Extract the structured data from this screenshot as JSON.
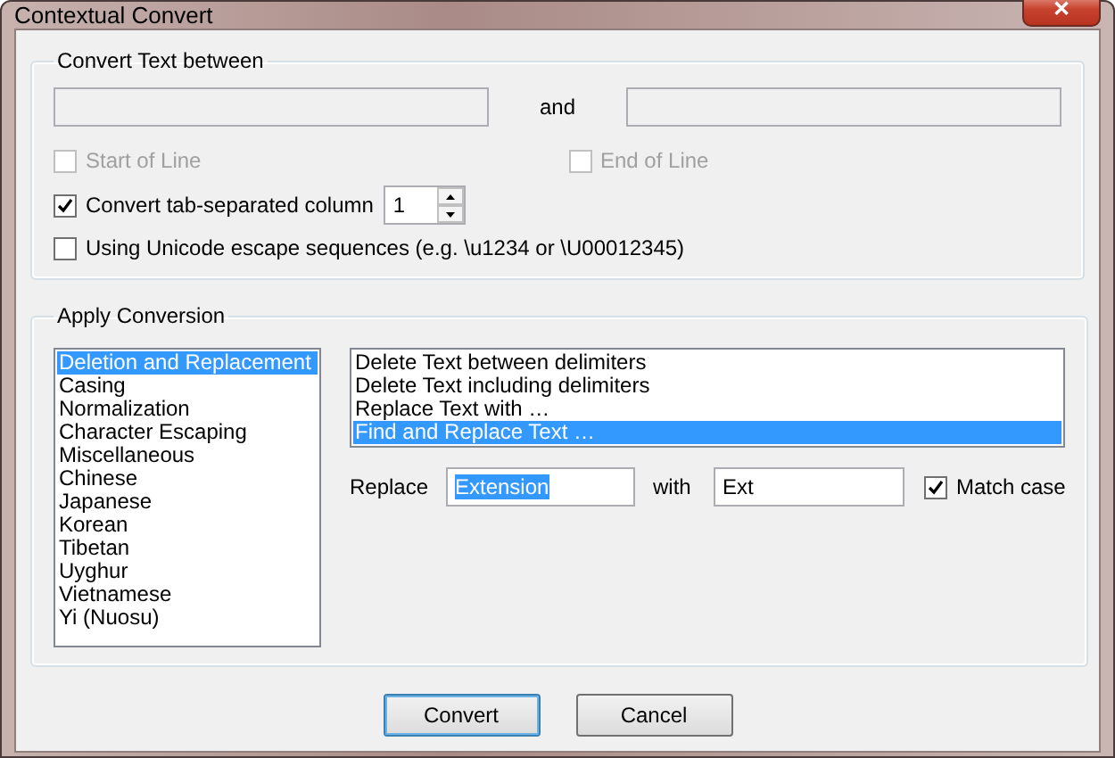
{
  "window": {
    "title": "Contextual Convert",
    "close": "✕"
  },
  "convert_between": {
    "title": "Convert Text between",
    "and_label": "and",
    "start_of_line": {
      "label": "Start of Line",
      "checked": false,
      "disabled": true
    },
    "end_of_line": {
      "label": "End of Line",
      "checked": false,
      "disabled": true
    },
    "tab_column": {
      "label": "Convert tab-separated column",
      "checked": true,
      "disabled": false,
      "value": "1"
    },
    "unicode_escape": {
      "label": "Using Unicode escape sequences (e.g.  \\u1234 or  \\U00012345)",
      "checked": false,
      "disabled": false
    }
  },
  "apply_conversion": {
    "title": "Apply Conversion",
    "categories": [
      {
        "label": "Deletion and Replacement",
        "selected": true
      },
      {
        "label": "Casing",
        "selected": false
      },
      {
        "label": "Normalization",
        "selected": false
      },
      {
        "label": "Character Escaping",
        "selected": false
      },
      {
        "label": "Miscellaneous",
        "selected": false
      },
      {
        "label": "Chinese",
        "selected": false
      },
      {
        "label": "Japanese",
        "selected": false
      },
      {
        "label": "Korean",
        "selected": false
      },
      {
        "label": "Tibetan",
        "selected": false
      },
      {
        "label": "Uyghur",
        "selected": false
      },
      {
        "label": "Vietnamese",
        "selected": false
      },
      {
        "label": "Yi (Nuosu)",
        "selected": false
      }
    ],
    "operations": [
      {
        "label": "Delete Text between delimiters",
        "selected": false
      },
      {
        "label": "Delete Text including delimiters",
        "selected": false
      },
      {
        "label": "Replace Text with …",
        "selected": false
      },
      {
        "label": "Find and Replace Text …",
        "selected": true
      }
    ],
    "replace_label": "Replace",
    "replace_value": "Extension",
    "replace_value_highlighted": true,
    "with_label": "with",
    "with_value": "Ext",
    "match_case": {
      "label": "Match case",
      "checked": true,
      "disabled": false
    }
  },
  "buttons": [
    {
      "label": "Convert",
      "default": true
    },
    {
      "label": "Cancel",
      "default": false
    }
  ]
}
